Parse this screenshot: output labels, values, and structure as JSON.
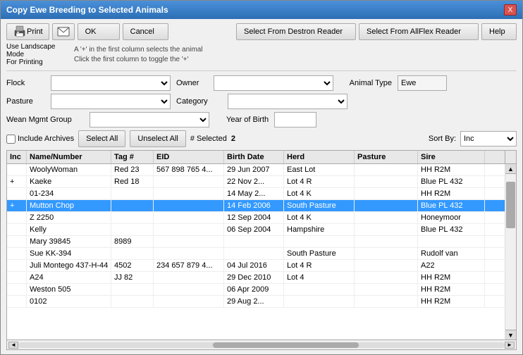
{
  "window": {
    "title": "Copy Ewe Breeding to Selected Animals",
    "close_label": "X"
  },
  "toolbar": {
    "print_label": "Print",
    "ok_label": "OK",
    "cancel_label": "Cancel",
    "select_destron_label": "Select From Destron Reader",
    "select_allflex_label": "Select From AllFlex Reader",
    "help_label": "Help"
  },
  "hints": {
    "line1": "A '+' in the first column selects the animal",
    "line2": "Click the first column to toggle the '+'"
  },
  "form": {
    "flock_label": "Flock",
    "owner_label": "Owner",
    "pasture_label": "Pasture",
    "category_label": "Category",
    "animal_type_label": "Animal Type",
    "animal_type_value": "Ewe",
    "wean_group_label": "Wean Mgmt Group",
    "year_birth_label": "Year of Birth"
  },
  "filter": {
    "include_archives_label": "Include Archives",
    "select_all_label": "Select All",
    "unselect_all_label": "Unselect All",
    "num_selected_label": "# Selected",
    "num_selected_value": "2",
    "sort_label": "Sort By:",
    "sort_value": "Inc"
  },
  "table": {
    "headers": [
      "Inc",
      "Name/Number",
      "Tag #",
      "EID",
      "Birth Date",
      "Herd",
      "Pasture",
      "Sire"
    ],
    "rows": [
      {
        "inc": "",
        "name": "WoolyWoman",
        "tag": "Red 23",
        "eid": "567 898 765 4...",
        "birth": "29 Jun 2007",
        "herd": "East Lot",
        "pasture": "",
        "sire": "HH R2M"
      },
      {
        "inc": "+",
        "name": "Kaeke",
        "tag": "Red 18",
        "eid": "",
        "birth": "22 Nov 2...",
        "herd": "Lot 4 R",
        "pasture": "",
        "sire": "Blue PL 432"
      },
      {
        "inc": "",
        "name": "01-234",
        "tag": "",
        "eid": "",
        "birth": "14 May 2...",
        "herd": "Lot 4 K",
        "pasture": "",
        "sire": "HH R2M"
      },
      {
        "inc": "+",
        "name": "Mutton Chop",
        "tag": "",
        "eid": "",
        "birth": "14 Feb 2006",
        "herd": "South Pasture",
        "pasture": "",
        "sire": "Blue PL 432",
        "selected": true
      },
      {
        "inc": "",
        "name": "Z 2250",
        "tag": "",
        "eid": "",
        "birth": "12 Sep 2004",
        "herd": "Lot 4 K",
        "pasture": "",
        "sire": "Honeymoor"
      },
      {
        "inc": "",
        "name": "Kelly",
        "tag": "",
        "eid": "",
        "birth": "06 Sep 2004",
        "herd": "Hampshire",
        "pasture": "",
        "sire": "Blue PL 432"
      },
      {
        "inc": "",
        "name": "Mary 39845",
        "tag": "8989",
        "eid": "",
        "birth": "",
        "herd": "",
        "pasture": "",
        "sire": ""
      },
      {
        "inc": "",
        "name": "Sue KK-394",
        "tag": "",
        "eid": "",
        "birth": "",
        "herd": "South Pasture",
        "pasture": "",
        "sire": "Rudolf van"
      },
      {
        "inc": "",
        "name": "Juli Montego 437-H-44",
        "tag": "4502",
        "eid": "234 657 879 4...",
        "birth": "04 Jul 2016",
        "herd": "Lot 4 R",
        "pasture": "",
        "sire": "A22"
      },
      {
        "inc": "",
        "name": "A24",
        "tag": "JJ 82",
        "eid": "",
        "birth": "29 Dec 2010",
        "herd": "Lot 4",
        "pasture": "",
        "sire": "HH R2M"
      },
      {
        "inc": "",
        "name": "Weston 505",
        "tag": "",
        "eid": "",
        "birth": "06 Apr 2009",
        "herd": "",
        "pasture": "",
        "sire": "HH R2M"
      },
      {
        "inc": "",
        "name": "0102",
        "tag": "",
        "eid": "",
        "birth": "29 Aug 2...",
        "herd": "",
        "pasture": "",
        "sire": "HH R2M"
      }
    ]
  }
}
